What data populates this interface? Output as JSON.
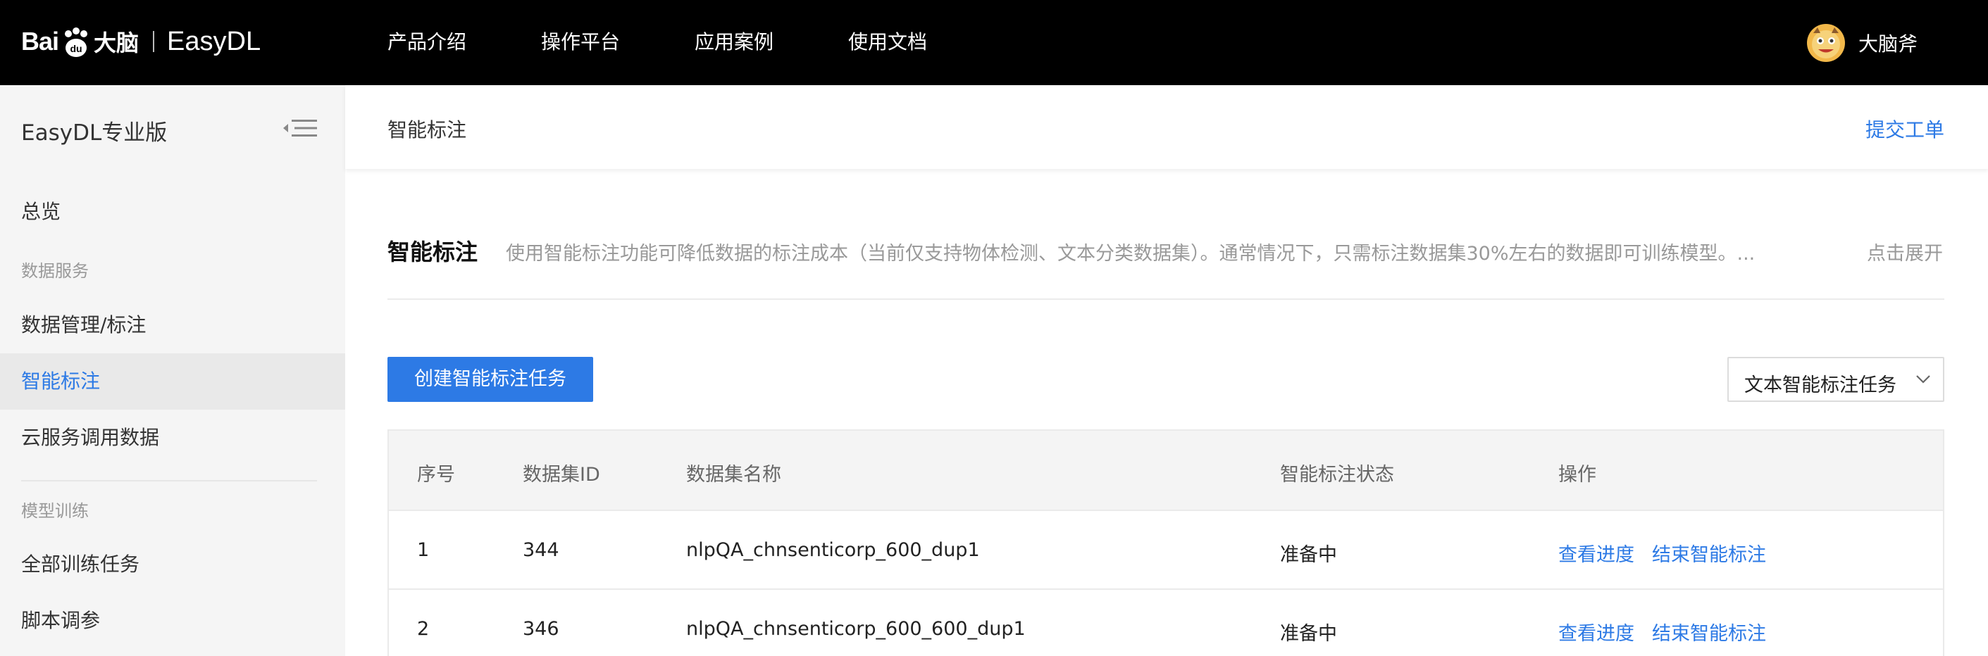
{
  "header": {
    "logo_bai": "Bai",
    "logo_dn": "大脑",
    "logo_product": "EasyDL",
    "nav": [
      "产品介绍",
      "操作平台",
      "应用案例",
      "使用文档"
    ],
    "user_name": "大脑斧"
  },
  "sidebar": {
    "title": "EasyDL专业版",
    "overview": "总览",
    "group_data": "数据服务",
    "items_data": [
      "数据管理/标注",
      "智能标注",
      "云服务调用数据"
    ],
    "group_model": "模型训练",
    "items_model": [
      "全部训练任务",
      "脚本调参"
    ],
    "active": "智能标注"
  },
  "subbar": {
    "breadcrumb": "智能标注",
    "ticket": "提交工单"
  },
  "intro": {
    "title": "智能标注",
    "desc": "使用智能标注功能可降低数据的标注成本（当前仅支持物体检测、文本分类数据集）。通常情况下，只需标注数据集30%左右的数据即可训练模型。...",
    "expand": "点击展开"
  },
  "toolbar": {
    "create_label": "创建智能标注任务",
    "select_value": "文本智能标注任务"
  },
  "table": {
    "columns": [
      "序号",
      "数据集ID",
      "数据集名称",
      "智能标注状态",
      "操作"
    ],
    "rows": [
      {
        "no": "1",
        "id": "344",
        "name": "nlpQA_chnsenticorp_600_dup1",
        "status": "准备中",
        "action_view": "查看进度",
        "action_end": "结束智能标注"
      },
      {
        "no": "2",
        "id": "346",
        "name": "nlpQA_chnsenticorp_600_600_dup1",
        "status": "准备中",
        "action_view": "查看进度",
        "action_end": "结束智能标注"
      }
    ]
  },
  "colors": {
    "accent": "#2d7ae5",
    "topbar": "#000000",
    "sidebar_bg": "#f5f5f5",
    "sidebar_active_bg": "#e9e9e9"
  },
  "icons": {
    "logo": "baidu-paw-icon",
    "collapse": "menu-collapse-icon",
    "select": "chevron-down-icon",
    "avatar": "user-avatar-icon"
  }
}
